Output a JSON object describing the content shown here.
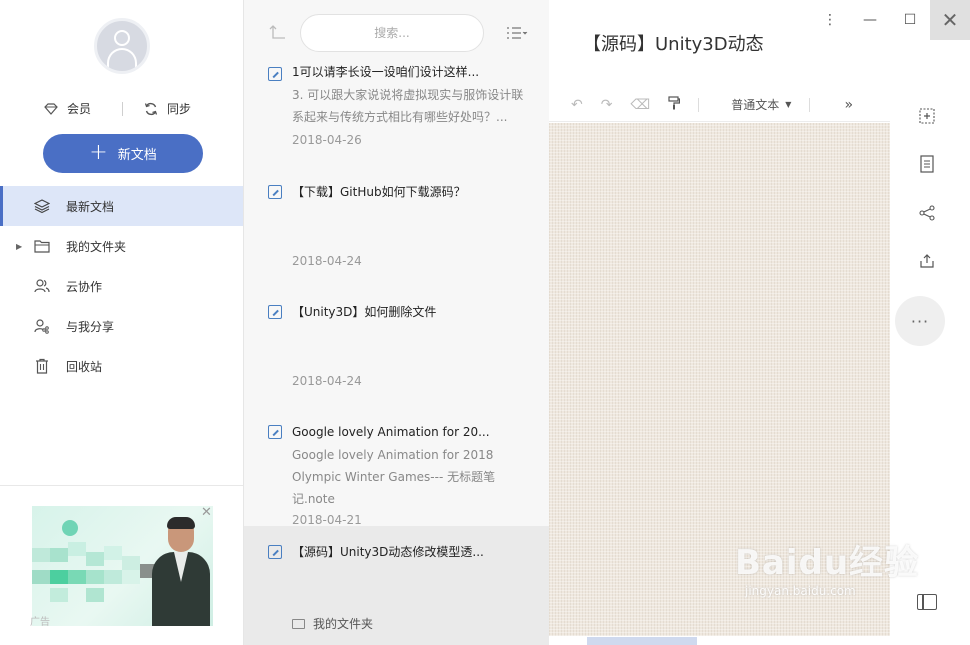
{
  "sidebar": {
    "vip_label": "会员",
    "sync_label": "同步",
    "new_doc_label": "新文档",
    "nav": [
      {
        "label": "最新文档",
        "icon": "layers-icon"
      },
      {
        "label": "我的文件夹",
        "icon": "folder-icon"
      },
      {
        "label": "云协作",
        "icon": "people-icon"
      },
      {
        "label": "与我分享",
        "icon": "share-user-icon"
      },
      {
        "label": "回收站",
        "icon": "trash-icon"
      }
    ],
    "ad_tag": "广告"
  },
  "list": {
    "search_placeholder": "搜索...",
    "docs": [
      {
        "title": "1可以请李长设一设咱们设计这样...",
        "snippet": "3. 可以跟大家说说将虚拟现实与服饰设计联系起来与传统方式相比有哪些好处吗？...",
        "date": "2018-04-26"
      },
      {
        "title": "【下载】GitHub如何下载源码？",
        "snippet": "",
        "date": "2018-04-24"
      },
      {
        "title": "【Unity3D】如何删除文件",
        "snippet": "",
        "date": "2018-04-24"
      },
      {
        "title": "Google lovely Animation for 20...",
        "snippet": "Google lovely Animation for 2018 Olympic Winter Games--- 无标题笔记.note",
        "date": "2018-04-21"
      },
      {
        "title": "【源码】Unity3D动态修改模型透...",
        "snippet": "",
        "date": ""
      }
    ],
    "folder_label": "我的文件夹"
  },
  "editor": {
    "title": "【源码】Unity3D动态",
    "format_label": "普通文本",
    "window": {
      "menu": "⋮",
      "minimize": "—",
      "maximize": "☐",
      "close": "✕"
    }
  },
  "watermark": {
    "logo": "Baidu经验",
    "url": "jingyan.baidu.com"
  },
  "colors": {
    "accent": "#4a6fc5",
    "active_nav_bg": "#dde6f8",
    "canvas_bg": "#efe8df"
  }
}
